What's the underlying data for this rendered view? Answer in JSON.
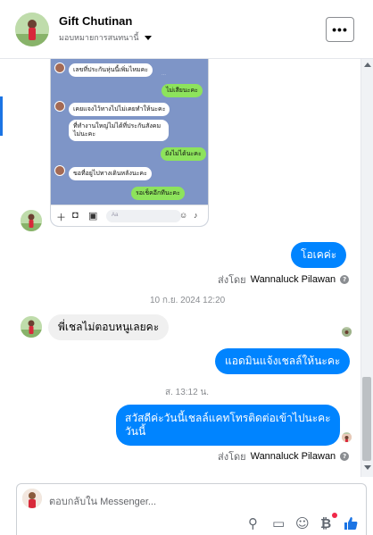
{
  "header": {
    "name": "Gift Chutinan",
    "subtitle": "มอบหมายการสนทนานี้",
    "more_label": "•••"
  },
  "shared_image": {
    "messages": [
      {
        "side": "in",
        "text": "เลขที่ประกันหุ่นนี้เพิ่มไหมคะ"
      },
      {
        "side": "out",
        "text": "ไม่เสียนะคะ"
      },
      {
        "side": "in",
        "text": "เคยแจงไว้ทางไปไม่เคยทำให้นะคะ"
      },
      {
        "side": "in",
        "text": "ที่ทำงานใหญ่ไม่ได้ที่ประกันสังคม"
      },
      {
        "side": "in",
        "text": "ไม่นะคะ"
      },
      {
        "side": "out",
        "text": "ยังไม่ได้นะคะ"
      },
      {
        "side": "in",
        "text": "ขอที่อยู่ไปทางเดินหลังนะคะ"
      },
      {
        "side": "out",
        "text": "รอเช็คอีกทีนะคะ"
      }
    ],
    "input_placeholder": "Aa"
  },
  "messages": {
    "m1": "โอเคค่ะ",
    "sent_by_1": {
      "prefix": "ส่งโดย",
      "name": "Wannaluck Pilawan"
    },
    "date_1": "10 ก.ย. 2024 12:20",
    "m2": "พี่เชลไม่ตอบหนูเลยคะ",
    "m3": "แอดมินแจ้งเชลล์ให้นะคะ",
    "date_2": "ส. 13:12 น.",
    "m4": "สวัสดีค่ะวันนี้เชลล์แคทโทรติดต่อเข้าไปนะคะวันนี้",
    "sent_by_2": {
      "prefix": "ส่งโดย",
      "name": "Wannaluck Pilawan"
    }
  },
  "composer": {
    "placeholder": "ตอบกลับใน Messenger..."
  },
  "icons": {
    "attach": "paperclip-icon",
    "comment": "speech-bubble-icon",
    "emoji": "smile-icon",
    "bot": "b-icon",
    "like": "thumbs-up-icon"
  },
  "colors": {
    "accent": "#0084ff",
    "like": "#1b74e4"
  }
}
